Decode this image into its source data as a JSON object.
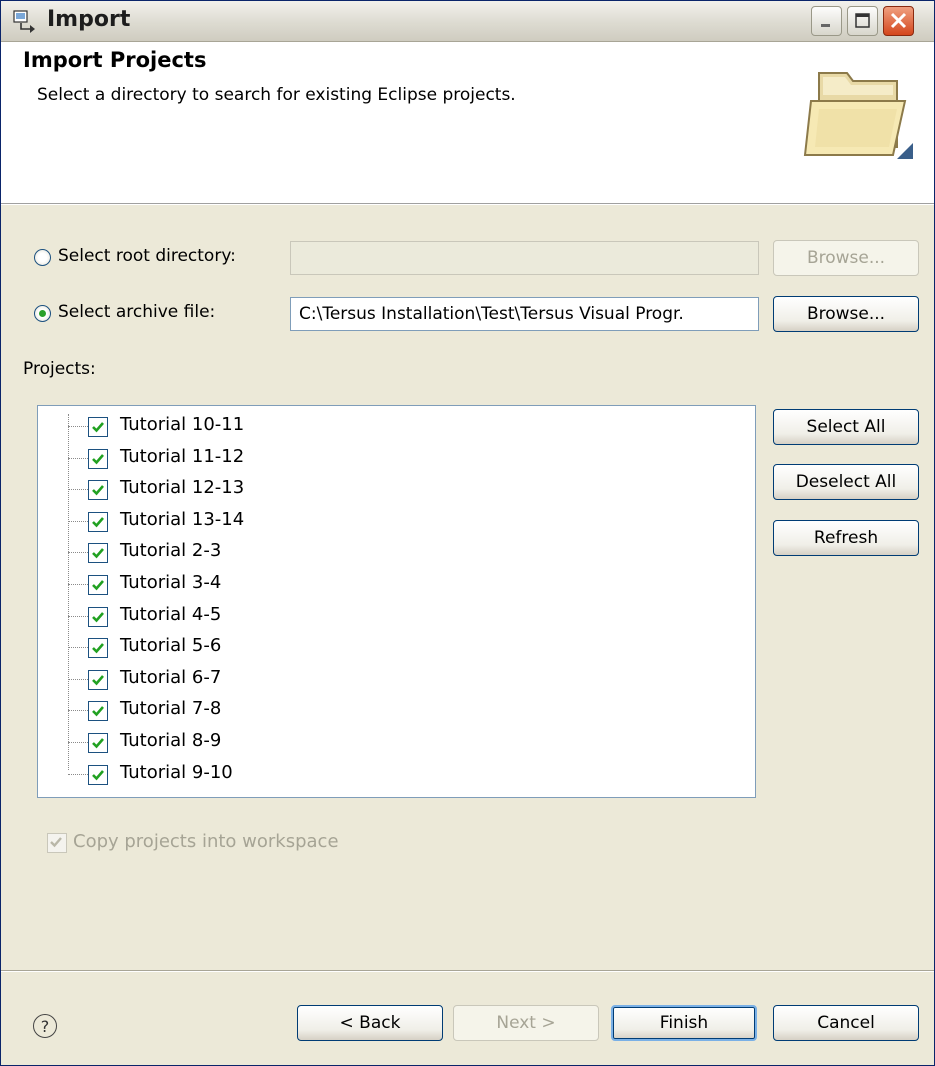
{
  "window": {
    "title": "Import",
    "controls": [
      "minimize",
      "maximize",
      "close"
    ]
  },
  "header": {
    "title": "Import Projects",
    "description": "Select a directory to search for existing Eclipse projects.",
    "icon": "folder-open-icon"
  },
  "source": {
    "root_directory": {
      "label": "Select root directory:",
      "value": "",
      "selected": false,
      "browse_label": "Browse...",
      "enabled": false
    },
    "archive_file": {
      "label": "Select archive file:",
      "value": "C:\\Tersus Installation\\Test\\Tersus Visual Progr.",
      "selected": true,
      "browse_label": "Browse...",
      "enabled": true
    }
  },
  "projects": {
    "label": "Projects:",
    "items": [
      {
        "name": "Tutorial 10-11",
        "checked": true
      },
      {
        "name": "Tutorial 11-12",
        "checked": true
      },
      {
        "name": "Tutorial 12-13",
        "checked": true
      },
      {
        "name": "Tutorial 13-14",
        "checked": true
      },
      {
        "name": "Tutorial 2-3",
        "checked": true
      },
      {
        "name": "Tutorial 3-4",
        "checked": true
      },
      {
        "name": "Tutorial 4-5",
        "checked": true
      },
      {
        "name": "Tutorial 5-6",
        "checked": true
      },
      {
        "name": "Tutorial 6-7",
        "checked": true
      },
      {
        "name": "Tutorial 7-8",
        "checked": true
      },
      {
        "name": "Tutorial 8-9",
        "checked": true
      },
      {
        "name": "Tutorial 9-10",
        "checked": true
      }
    ],
    "select_all": "Select All",
    "deselect_all": "Deselect All",
    "refresh": "Refresh"
  },
  "options": {
    "copy_into_workspace": {
      "label": "Copy projects into workspace",
      "checked": true,
      "enabled": false
    }
  },
  "footer": {
    "help": "?",
    "back": "< Back",
    "next": "Next >",
    "finish": "Finish",
    "cancel": "Cancel"
  },
  "colors": {
    "dialog_bg": "#ece9d8",
    "banner_bg": "#ffffff",
    "check_green": "#21a121",
    "close_red": "#d4461c",
    "disabled_text": "#a6a495"
  }
}
